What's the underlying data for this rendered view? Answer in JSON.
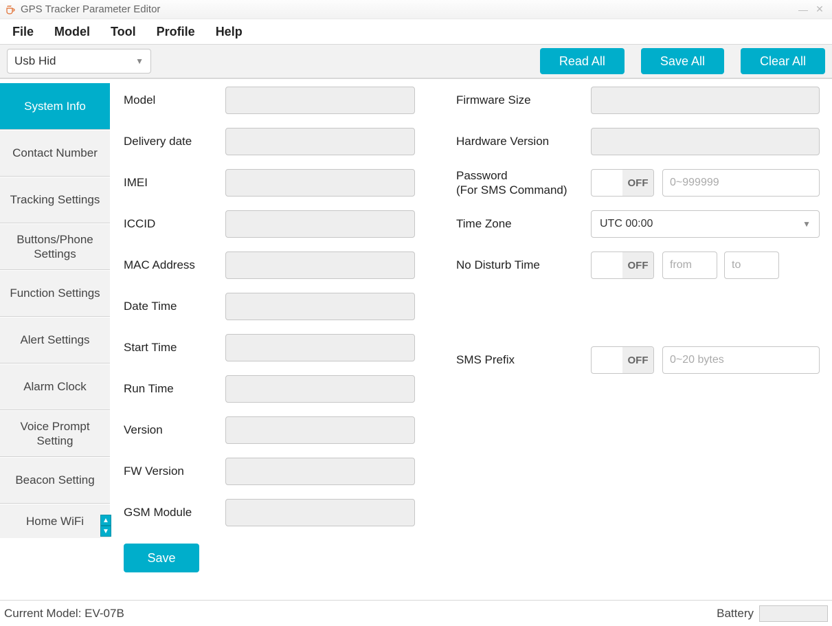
{
  "window": {
    "title": "GPS Tracker Parameter Editor"
  },
  "menubar": {
    "items": [
      "File",
      "Model",
      "Tool",
      "Profile",
      "Help"
    ]
  },
  "toolbar": {
    "connection": "Usb Hid",
    "read_all": "Read All",
    "save_all": "Save All",
    "clear_all": "Clear All"
  },
  "sidebar": {
    "items": [
      "System Info",
      "Contact Number",
      "Tracking Settings",
      "Buttons/Phone Settings",
      "Function Settings",
      "Alert Settings",
      "Alarm Clock",
      "Voice Prompt Setting",
      "Beacon Setting",
      "Home WiFi"
    ],
    "active_index": 0
  },
  "left_fields": {
    "model": "Model",
    "delivery_date": "Delivery date",
    "imei": "IMEI",
    "iccid": "ICCID",
    "mac": "MAC Address",
    "datetime": "Date Time",
    "starttime": "Start Time",
    "runtime": "Run Time",
    "version": "Version",
    "fwversion": "FW Version",
    "gsm": "GSM Module"
  },
  "right_fields": {
    "fwsize": "Firmware Size",
    "hwver": "Hardware Version",
    "password_label": "Password\n(For SMS Command)",
    "password_l1": "Password",
    "password_l2": "(For SMS Command)",
    "timezone": "Time Zone",
    "timezone_value": "UTC 00:00",
    "nodisturb": "No Disturb Time",
    "smsprefix": "SMS Prefix"
  },
  "toggles": {
    "off_label": "OFF"
  },
  "placeholders": {
    "password": "0~999999",
    "from": "from",
    "to": "to",
    "smsprefix": "0~20 bytes"
  },
  "buttons": {
    "save": "Save"
  },
  "status": {
    "current_model_label": "Current Model: EV-07B",
    "battery_label": "Battery"
  }
}
